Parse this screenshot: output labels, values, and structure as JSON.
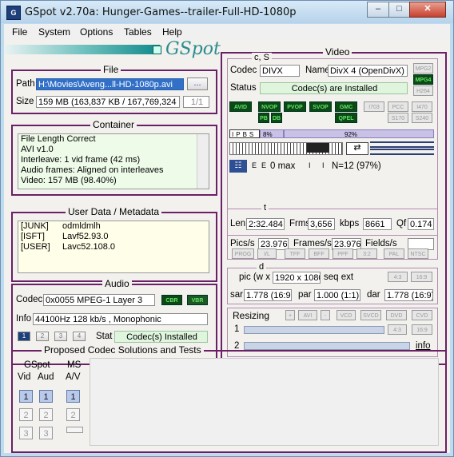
{
  "window": {
    "title": "GSpot v2.70a: Hunger-Games--trailer-Full-HD-1080p",
    "minimize": "–",
    "maximize": "□",
    "close": "✕"
  },
  "menu": [
    "File",
    "System",
    "Options",
    "Tables",
    "Help"
  ],
  "logo": "GSpot",
  "file": {
    "title": "File",
    "path_label": "Path",
    "path_value": "H:\\Movies\\Aveng...ll-HD-1080p.avi",
    "browse": "...",
    "size_label": "Size",
    "size_value": "159 MB (163,837 KB / 167,769,324",
    "page": "1/1"
  },
  "container": {
    "title": "Container",
    "items": [
      "File Length Correct",
      "AVI v1.0",
      "Interleave: 1 vid frame (42 ms)",
      "Audio frames: Aligned on interleaves",
      "Video: 157 MB (98.40%)"
    ]
  },
  "metadata": {
    "title": "User Data / Metadata",
    "rows": [
      [
        "[JUNK]",
        "odmldmlh"
      ],
      [
        "[ISFT]",
        "Lavf52.93.0"
      ],
      [
        "[USER]",
        "Lavc52.108.0"
      ]
    ]
  },
  "audio": {
    "title": "Audio",
    "codec_label": "Codec",
    "codec_value": "0x0055 MPEG-1 Layer 3",
    "cbr": "CBR",
    "vbr": "VBR",
    "info_label": "Info",
    "info_value": "44100Hz  128 kb/s , Monophonic",
    "streams": [
      "1",
      "2",
      "3",
      "4"
    ],
    "stat_label": "Stat",
    "stat_value": "Codec(s) Installed"
  },
  "video": {
    "title": "Video",
    "cs_title": "c, S",
    "codec_label": "Codec",
    "codec_value": "DIVX",
    "name_label": "Name",
    "name_value": "DivX 4 (OpenDivX)",
    "status_label": "Status",
    "status_value": "Codec(s) are Installed",
    "fmt_buttons": [
      "MPG2",
      "MPG4",
      "H264"
    ],
    "type_row1": [
      "AVID",
      "NVOP",
      "PVOP",
      "SVOP",
      "GMC",
      "I703",
      "PCC",
      "I470"
    ],
    "type_row2": [
      "PB",
      "DB",
      "QPEL",
      "S170",
      "S240"
    ],
    "frametypes": [
      "I",
      "P",
      "B",
      "S"
    ],
    "pct_a": "8%",
    "pct_b": "92%",
    "max_label": "0 max",
    "n_label": "N=12 (97%)",
    "e_label": "E",
    "i_label": "I",
    "t_title": "t",
    "len_label": "Len",
    "len_value": "2:32.484",
    "frms_label": "Frms",
    "frms_value": "3,656",
    "kbps_label": "kbps",
    "kbps_value": "8661",
    "qf_label": "Qf",
    "qf_value": "0.174",
    "pics_label": "Pics/s",
    "pics_value": "23.976",
    "frames_label": "Frames/s",
    "frames_value": "23.976",
    "fields_label": "Fields/s",
    "pulldown": [
      "PROG",
      "I/L",
      "TFF",
      "BFF",
      "PPF",
      "3:2",
      "PAL",
      "NTSC"
    ],
    "d_title": "d",
    "pic_label": "pic (w x",
    "pic_value": "1920 x 1080",
    "seqext_label": "seq ext",
    "ar_btns": [
      "4:3",
      "16:9"
    ],
    "sar_label": "sar",
    "sar_value": "1.778 (16:9)",
    "par_label": "par",
    "par_value": "1.000 (1:1)",
    "dar_label": "dar",
    "dar_value": "1.778 (16:9)",
    "resizing_label": "Resizing",
    "resize_btns": [
      "+",
      "AVI",
      "-",
      "VCD",
      "SVCD",
      "DVD",
      "CVD"
    ],
    "resize_row1": [
      "4:3",
      "16:9"
    ],
    "row1_label": "1",
    "row2_label": "2",
    "info_link": "info"
  },
  "proposed": {
    "title": "Proposed Codec Solutions and Tests",
    "gspot_label": "GSpot",
    "vid_label": "Vid",
    "aud_label": "Aud",
    "ms_label": "MS",
    "av_label": "A/V",
    "nums": [
      "1",
      "2",
      "3"
    ]
  }
}
